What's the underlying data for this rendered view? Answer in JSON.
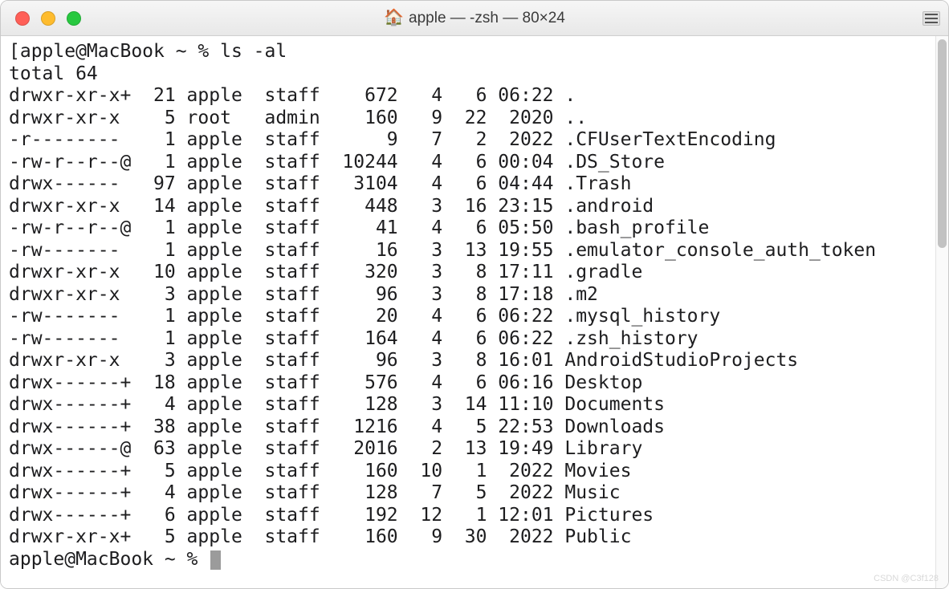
{
  "window": {
    "title": "apple — -zsh — 80×24"
  },
  "prompt": {
    "open_bracket": "[",
    "user_host": "apple@MacBook",
    "cwd": "~",
    "symbol": "%",
    "command": "ls -al"
  },
  "total_line": "total 64",
  "listing": [
    {
      "perm": "drwxr-xr-x+",
      "links": "21",
      "owner": "apple",
      "group": "staff",
      "size": "672",
      "m": "4",
      "d": "6",
      "t": "06:22",
      "name": "."
    },
    {
      "perm": "drwxr-xr-x",
      "links": "5",
      "owner": "root",
      "group": "admin",
      "size": "160",
      "m": "9",
      "d": "22",
      "t": "2020",
      "name": ".."
    },
    {
      "perm": "-r--------",
      "links": "1",
      "owner": "apple",
      "group": "staff",
      "size": "9",
      "m": "7",
      "d": "2",
      "t": "2022",
      "name": ".CFUserTextEncoding"
    },
    {
      "perm": "-rw-r--r--@",
      "links": "1",
      "owner": "apple",
      "group": "staff",
      "size": "10244",
      "m": "4",
      "d": "6",
      "t": "00:04",
      "name": ".DS_Store"
    },
    {
      "perm": "drwx------",
      "links": "97",
      "owner": "apple",
      "group": "staff",
      "size": "3104",
      "m": "4",
      "d": "6",
      "t": "04:44",
      "name": ".Trash"
    },
    {
      "perm": "drwxr-xr-x",
      "links": "14",
      "owner": "apple",
      "group": "staff",
      "size": "448",
      "m": "3",
      "d": "16",
      "t": "23:15",
      "name": ".android"
    },
    {
      "perm": "-rw-r--r--@",
      "links": "1",
      "owner": "apple",
      "group": "staff",
      "size": "41",
      "m": "4",
      "d": "6",
      "t": "05:50",
      "name": ".bash_profile"
    },
    {
      "perm": "-rw-------",
      "links": "1",
      "owner": "apple",
      "group": "staff",
      "size": "16",
      "m": "3",
      "d": "13",
      "t": "19:55",
      "name": ".emulator_console_auth_token"
    },
    {
      "perm": "drwxr-xr-x",
      "links": "10",
      "owner": "apple",
      "group": "staff",
      "size": "320",
      "m": "3",
      "d": "8",
      "t": "17:11",
      "name": ".gradle"
    },
    {
      "perm": "drwxr-xr-x",
      "links": "3",
      "owner": "apple",
      "group": "staff",
      "size": "96",
      "m": "3",
      "d": "8",
      "t": "17:18",
      "name": ".m2"
    },
    {
      "perm": "-rw-------",
      "links": "1",
      "owner": "apple",
      "group": "staff",
      "size": "20",
      "m": "4",
      "d": "6",
      "t": "06:22",
      "name": ".mysql_history"
    },
    {
      "perm": "-rw-------",
      "links": "1",
      "owner": "apple",
      "group": "staff",
      "size": "164",
      "m": "4",
      "d": "6",
      "t": "06:22",
      "name": ".zsh_history"
    },
    {
      "perm": "drwxr-xr-x",
      "links": "3",
      "owner": "apple",
      "group": "staff",
      "size": "96",
      "m": "3",
      "d": "8",
      "t": "16:01",
      "name": "AndroidStudioProjects"
    },
    {
      "perm": "drwx------+",
      "links": "18",
      "owner": "apple",
      "group": "staff",
      "size": "576",
      "m": "4",
      "d": "6",
      "t": "06:16",
      "name": "Desktop"
    },
    {
      "perm": "drwx------+",
      "links": "4",
      "owner": "apple",
      "group": "staff",
      "size": "128",
      "m": "3",
      "d": "14",
      "t": "11:10",
      "name": "Documents"
    },
    {
      "perm": "drwx------+",
      "links": "38",
      "owner": "apple",
      "group": "staff",
      "size": "1216",
      "m": "4",
      "d": "5",
      "t": "22:53",
      "name": "Downloads"
    },
    {
      "perm": "drwx------@",
      "links": "63",
      "owner": "apple",
      "group": "staff",
      "size": "2016",
      "m": "2",
      "d": "13",
      "t": "19:49",
      "name": "Library"
    },
    {
      "perm": "drwx------+",
      "links": "5",
      "owner": "apple",
      "group": "staff",
      "size": "160",
      "m": "10",
      "d": "1",
      "t": "2022",
      "name": "Movies"
    },
    {
      "perm": "drwx------+",
      "links": "4",
      "owner": "apple",
      "group": "staff",
      "size": "128",
      "m": "7",
      "d": "5",
      "t": "2022",
      "name": "Music"
    },
    {
      "perm": "drwx------+",
      "links": "6",
      "owner": "apple",
      "group": "staff",
      "size": "192",
      "m": "12",
      "d": "1",
      "t": "12:01",
      "name": "Pictures"
    },
    {
      "perm": "drwxr-xr-x+",
      "links": "5",
      "owner": "apple",
      "group": "staff",
      "size": "160",
      "m": "9",
      "d": "30",
      "t": "2022",
      "name": "Public"
    }
  ],
  "prompt2": {
    "user_host": "apple@MacBook",
    "cwd": "~",
    "symbol": "%"
  },
  "watermark": "CSDN @C3f128"
}
